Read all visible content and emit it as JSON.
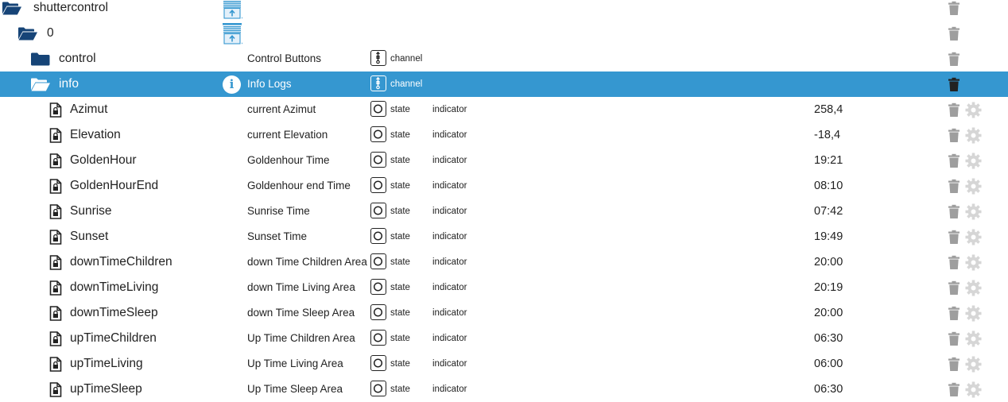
{
  "rows": [
    {
      "id": "shuttercontrol",
      "level": 0,
      "kind": "folder-open",
      "name": "shuttercontrol",
      "desc": "",
      "type": "",
      "role": "",
      "value": "",
      "enum": true
    },
    {
      "id": "0",
      "level": 1,
      "kind": "folder-open",
      "name": "0",
      "desc": "",
      "type": "",
      "role": "",
      "value": "",
      "enum": true
    },
    {
      "id": "control",
      "level": 2,
      "kind": "folder-closed",
      "name": "control",
      "desc": "Control Buttons",
      "type": "channel",
      "role": "",
      "value": ""
    },
    {
      "id": "info",
      "level": 2,
      "kind": "folder-open",
      "name": "info",
      "desc": "Info Logs",
      "type": "channel",
      "role": "",
      "value": "",
      "selected": true,
      "info": true
    },
    {
      "id": "Azimut",
      "level": 3,
      "kind": "file",
      "name": "Azimut",
      "desc": "current Azimut",
      "type": "state",
      "role": "indicator",
      "value": "258,4"
    },
    {
      "id": "Elevation",
      "level": 3,
      "kind": "file",
      "name": "Elevation",
      "desc": "current Elevation",
      "type": "state",
      "role": "indicator",
      "value": "-18,4"
    },
    {
      "id": "GoldenHour",
      "level": 3,
      "kind": "file",
      "name": "GoldenHour",
      "desc": "Goldenhour Time",
      "type": "state",
      "role": "indicator",
      "value": "19:21"
    },
    {
      "id": "GoldenHourEnd",
      "level": 3,
      "kind": "file",
      "name": "GoldenHourEnd",
      "desc": "Goldenhour end Time",
      "type": "state",
      "role": "indicator",
      "value": "08:10"
    },
    {
      "id": "Sunrise",
      "level": 3,
      "kind": "file",
      "name": "Sunrise",
      "desc": "Sunrise Time",
      "type": "state",
      "role": "indicator",
      "value": "07:42"
    },
    {
      "id": "Sunset",
      "level": 3,
      "kind": "file",
      "name": "Sunset",
      "desc": "Sunset Time",
      "type": "state",
      "role": "indicator",
      "value": "19:49"
    },
    {
      "id": "downTimeChildren",
      "level": 3,
      "kind": "file",
      "name": "downTimeChildren",
      "desc": "down Time Children Area",
      "type": "state",
      "role": "indicator",
      "value": "20:00"
    },
    {
      "id": "downTimeLiving",
      "level": 3,
      "kind": "file",
      "name": "downTimeLiving",
      "desc": "down Time Living Area",
      "type": "state",
      "role": "indicator",
      "value": "20:19"
    },
    {
      "id": "downTimeSleep",
      "level": 3,
      "kind": "file",
      "name": "downTimeSleep",
      "desc": "down Time Sleep Area",
      "type": "state",
      "role": "indicator",
      "value": "20:00"
    },
    {
      "id": "upTimeChildren",
      "level": 3,
      "kind": "file",
      "name": "upTimeChildren",
      "desc": "Up Time Children Area",
      "type": "state",
      "role": "indicator",
      "value": "06:30"
    },
    {
      "id": "upTimeLiving",
      "level": 3,
      "kind": "file",
      "name": "upTimeLiving",
      "desc": "Up Time Living Area",
      "type": "state",
      "role": "indicator",
      "value": "06:00"
    },
    {
      "id": "upTimeSleep",
      "level": 3,
      "kind": "file",
      "name": "upTimeSleep",
      "desc": "Up Time Sleep Area",
      "type": "state",
      "role": "indicator",
      "value": "06:30"
    }
  ],
  "colors": {
    "folder": "#164477",
    "file": "#222222",
    "selected_bg": "#3597d0",
    "trash": "#9e9e9e",
    "gear": "#d6d6d6",
    "enum_icon": "#3597d0"
  },
  "icons": {
    "folder_open": "folder-open-icon",
    "folder_closed": "folder-icon",
    "file": "file-lock-icon",
    "channel": "channel-icon",
    "state": "state-icon",
    "info": "info-icon",
    "enum": "enum-blinds-icon",
    "delete": "trash-icon",
    "settings": "gear-icon"
  }
}
